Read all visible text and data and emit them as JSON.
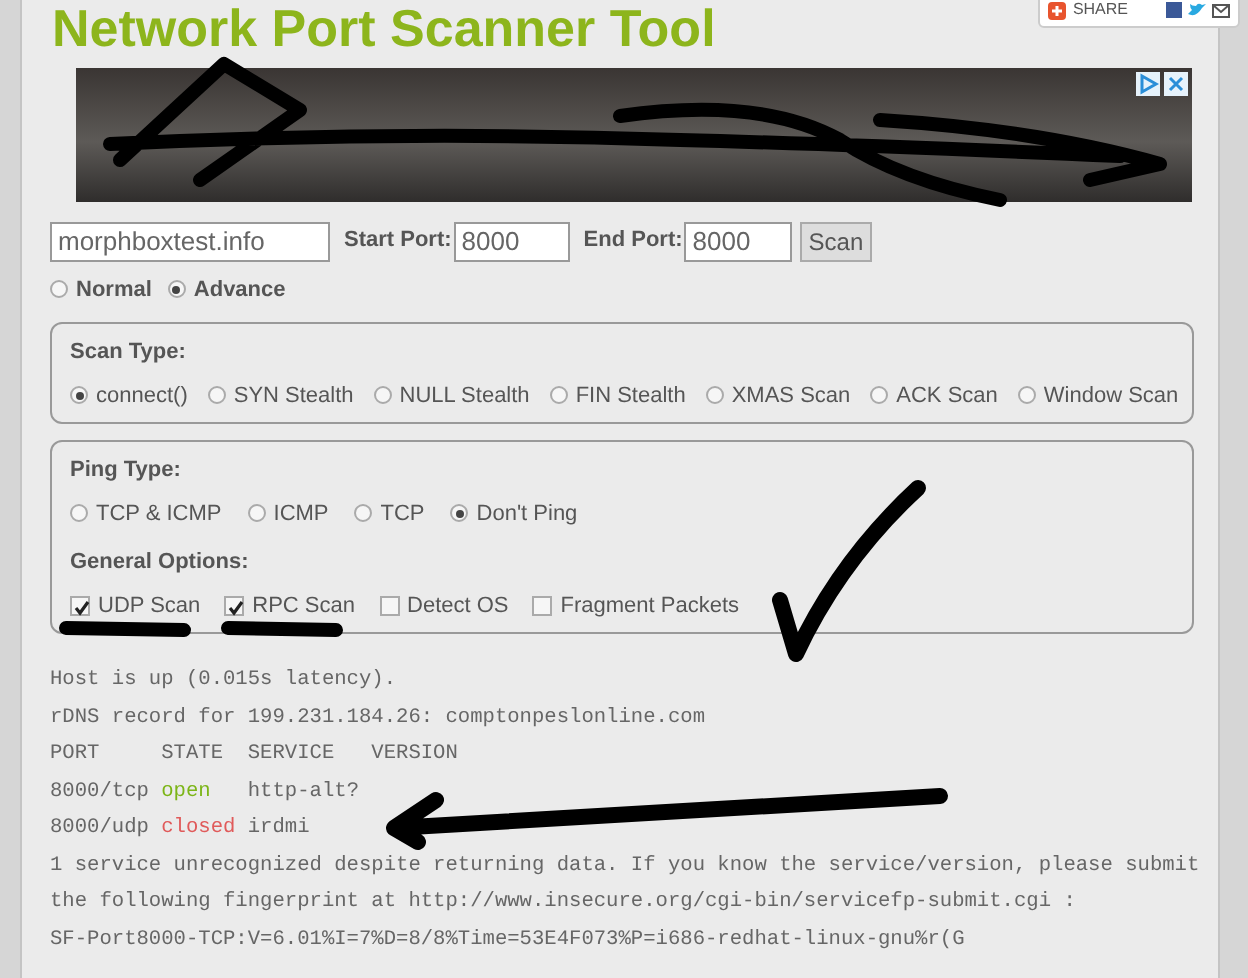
{
  "title": "Network Port Scanner Tool",
  "share": {
    "label": "SHARE"
  },
  "form": {
    "host": "morphboxtest.info",
    "start_port_label": "Start Port:",
    "start_port": "8000",
    "end_port_label": "End Port:",
    "end_port": "8000",
    "scan_button": "Scan"
  },
  "modes": [
    {
      "label": "Normal",
      "selected": false
    },
    {
      "label": "Advance",
      "selected": true
    }
  ],
  "scan_type": {
    "title": "Scan Type:",
    "options": [
      {
        "label": "connect()",
        "selected": true
      },
      {
        "label": "SYN Stealth",
        "selected": false
      },
      {
        "label": "NULL Stealth",
        "selected": false
      },
      {
        "label": "FIN Stealth",
        "selected": false
      },
      {
        "label": "XMAS Scan",
        "selected": false
      },
      {
        "label": "ACK Scan",
        "selected": false
      },
      {
        "label": "Window Scan",
        "selected": false
      }
    ]
  },
  "ping_type": {
    "title": "Ping Type:",
    "options": [
      {
        "label": "TCP & ICMP",
        "selected": false
      },
      {
        "label": "ICMP",
        "selected": false
      },
      {
        "label": "TCP",
        "selected": false
      },
      {
        "label": "Don't Ping",
        "selected": true
      }
    ]
  },
  "general_options": {
    "title": "General Options:",
    "options": [
      {
        "label": "UDP Scan",
        "checked": true
      },
      {
        "label": "RPC Scan",
        "checked": true
      },
      {
        "label": "Detect OS",
        "checked": false
      },
      {
        "label": "Fragment Packets",
        "checked": false
      }
    ]
  },
  "output": [
    {
      "kind": "text",
      "text": "Host is up (0.015s latency)."
    },
    {
      "kind": "text",
      "text": "rDNS record for 199.231.184.26: comptonpeslonline.com"
    },
    {
      "kind": "header",
      "text": "PORT     STATE  SERVICE   VERSION"
    },
    {
      "kind": "port",
      "port": "8000/tcp",
      "state": "open",
      "service": "http-alt?",
      "color": "#7cb518"
    },
    {
      "kind": "port",
      "port": "8000/udp",
      "state": "closed",
      "service": "irdmi",
      "color": "#e05a5a"
    },
    {
      "kind": "text",
      "text": "1 service unrecognized despite returning data. If you know the service/version, please submit"
    },
    {
      "kind": "text",
      "text": "the following fingerprint at http://www.insecure.org/cgi-bin/servicefp-submit.cgi :"
    },
    {
      "kind": "text",
      "text": "SF-Port8000-TCP:V=6.01%I=7%D=8/8%Time=53E4F073%P=i686-redhat-linux-gnu%r(G"
    }
  ]
}
